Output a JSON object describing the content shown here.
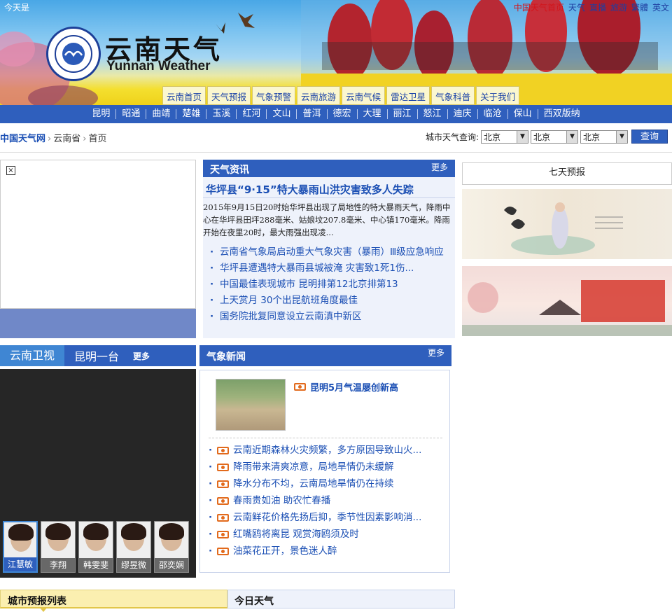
{
  "header": {
    "top_left": "今天是",
    "top_links": [
      "中国天气首页",
      "天气",
      "直播",
      "旅游",
      "繁體",
      "英文"
    ],
    "logo_cn": "云南天气",
    "logo_en": "Yunnan Weather",
    "main_tabs": [
      "云南首页",
      "天气预报",
      "气象预警",
      "云南旅游",
      "云南气候",
      "雷达卫星",
      "气象科普",
      "关于我们"
    ]
  },
  "cities": [
    "昆明",
    "昭通",
    "曲靖",
    "楚雄",
    "玉溪",
    "红河",
    "文山",
    "普洱",
    "德宏",
    "大理",
    "丽江",
    "怒江",
    "迪庆",
    "临沧",
    "保山",
    "西双版纳"
  ],
  "breadcrumb": {
    "home": "中国天气网",
    "level2": "云南省",
    "current": "首页"
  },
  "query": {
    "label": "城市天气查询:",
    "sel1": "北京",
    "sel2": "北京",
    "sel3": "北京",
    "button": "查询"
  },
  "weather_news": {
    "title": "天气资讯",
    "more": "更多",
    "headline": "华坪县“9·15”特大暴雨山洪灾害致多人失踪",
    "summary": "2015年9月15日20时始华坪县出现了局地性的特大暴雨天气，降雨中心在华坪县田坪288毫米、姑娘坟207.8毫米、中心镇170毫米。降雨开始在夜里20时，最大雨强出现凌...",
    "items": [
      "云南省气象局启动重大气象灾害（暴雨）Ⅲ级应急响应",
      "华坪县遭遇特大暴雨县城被淹 灾害致1死1伤...",
      "中国最佳表现城市 昆明排第12北京排第13",
      "上天赏月 30个出昆航班角度最佳",
      "国务院批复同意设立云南滇中新区"
    ]
  },
  "seven_day": "七天预报",
  "tv": {
    "tab1": "云南卫视",
    "tab2": "昆明一台",
    "more": "更多",
    "anchors": [
      "江慧敏",
      "李翔",
      "韩雯斐",
      "缪昱微",
      "邵奕娴"
    ]
  },
  "met_news": {
    "title": "气象新闻",
    "more": "更多",
    "feature": "昆明5月气温屡创新高",
    "items": [
      "云南近期森林火灾频繁，多方原因导致山火...",
      "降雨带来清爽凉意，局地旱情仍未缓解",
      "降水分布不均，云南局地旱情仍在持续",
      "春雨贵如油 助农忙春播",
      "云南鲜花价格先扬后抑，季节性因素影响消...",
      "红嘴鸥将离昆 观赏海鸥须及时",
      "油菜花正开，景色迷人醉"
    ]
  },
  "bottom": {
    "tab1": "城市预报列表",
    "tab2": "今日天气"
  },
  "colors": {
    "nav_blue": "#2f5fbd",
    "link_blue": "#1b4fb4",
    "accent_red": "#d2141a"
  }
}
